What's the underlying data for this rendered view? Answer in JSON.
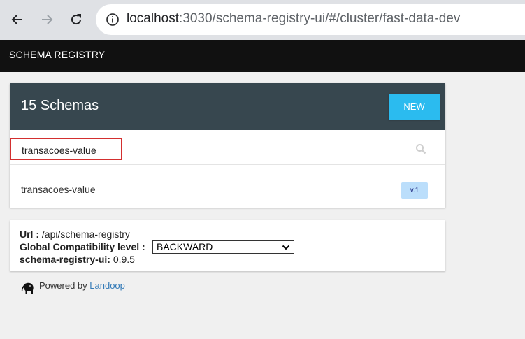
{
  "browser": {
    "url_host": "localhost",
    "url_rest": ":3030/schema-registry-ui/#/cluster/fast-data-dev"
  },
  "app": {
    "title": "SCHEMA REGISTRY"
  },
  "schemas": {
    "count_title": "15 Schemas",
    "new_label": "NEW",
    "search_value": "transacoes-value",
    "results": [
      {
        "name": "transacoes-value",
        "version": "v.1"
      }
    ]
  },
  "info": {
    "url_label": "Url :",
    "url_value": "/api/schema-registry",
    "compat_label": "Global Compatibility level :",
    "compat_value": "BACKWARD",
    "ui_label": "schema-registry-ui:",
    "ui_version": "0.9.5"
  },
  "footer": {
    "powered_by": "Powered by",
    "link_text": "Landoop"
  },
  "colors": {
    "card_header": "#37474f",
    "new_button": "#2bbbef",
    "search_highlight": "#d32f2f",
    "badge": "#bbdefb"
  }
}
